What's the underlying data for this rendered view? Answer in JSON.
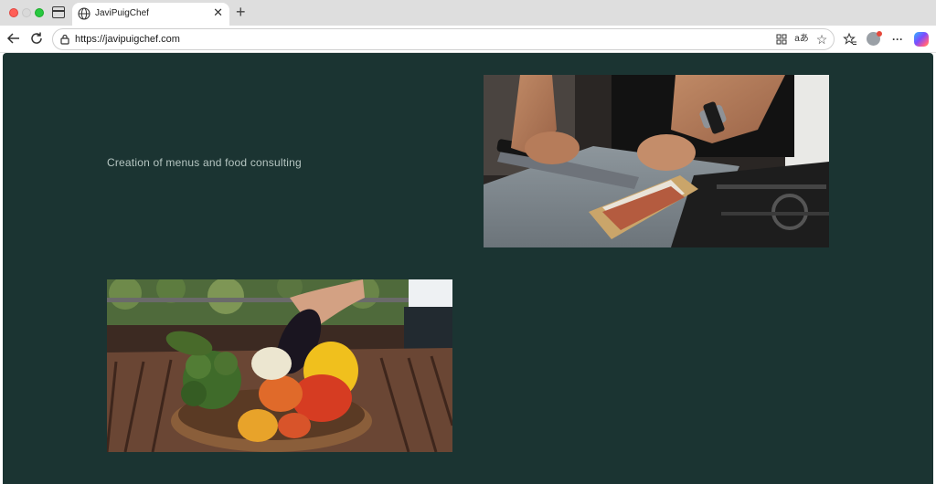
{
  "browser": {
    "tab_title": "JaviPuigChef",
    "url": "https://javipuigchef.com",
    "icons": {
      "close_window": "close-window-icon",
      "sidebar": "sidebar-icon",
      "tab_favicon": "globe-icon",
      "tab_close": "close-icon",
      "new_tab": "plus-icon",
      "back": "back-arrow-icon",
      "reload": "reload-icon",
      "lock": "lock-icon",
      "apps": "apps-icon",
      "translate": "translate-icon",
      "favorite": "star-icon",
      "favorites": "favorites-icon",
      "profile": "profile-icon",
      "more": "more-icon",
      "copilot": "copilot-icon"
    },
    "glyphs": {
      "tab_close": "✕",
      "new_tab": "+",
      "translate": "aあ",
      "favorite": "☆",
      "more": "···"
    }
  },
  "page": {
    "background_color": "#1b3432",
    "tagline": "Creation of menus and food consulting",
    "images": {
      "knife": "knife-sharpening-photo",
      "vegetables": "vegetable-bowl-photo"
    }
  }
}
